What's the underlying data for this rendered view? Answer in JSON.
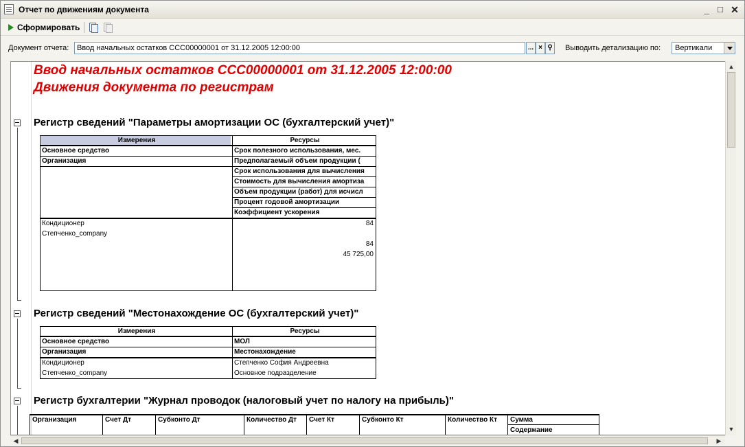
{
  "window": {
    "title": "Отчет по движениям документа",
    "minimize": "_",
    "maximize": "□",
    "close": "✕"
  },
  "toolbar": {
    "run_label": "Сформировать"
  },
  "params": {
    "doc_label": "Документ отчета:",
    "doc_value": "Ввод начальных остатков ССС00000001 от 31.12.2005 12:00:00",
    "dots": "...",
    "clear": "×",
    "detail_label": "Выводить детализацию по:",
    "detail_value": "Вертикали"
  },
  "report": {
    "title1": "Ввод начальных остатков ССС00000001 от 31.12.2005 12:00:00",
    "title2": "Движения документа по регистрам",
    "sec1": {
      "title": "Регистр сведений \"Параметры амортизации ОС (бухгалтерский учет)\"",
      "dims_header": "Измерения",
      "res_header": "Ресурсы",
      "dims": [
        "Основное средство",
        "Организация"
      ],
      "resources": [
        "Срок полезного использования, мес.",
        "Предполагаемый объем продукции (",
        "Срок использования для вычисления",
        "Стоимость для вычисления амортиза",
        "Объем продукции (работ) для исчисл",
        "Процент годовой амортизации",
        "Коэффициент ускорения"
      ],
      "dim_values": [
        "Кондиционер",
        "Степченко_company"
      ],
      "res_values": [
        "84",
        "",
        "84",
        "45 725,00"
      ]
    },
    "sec2": {
      "title": "Регистр сведений \"Местонахождение ОС (бухгалтерский учет)\"",
      "dims_header": "Измерения",
      "res_header": "Ресурсы",
      "dims": [
        "Основное средство",
        "Организация"
      ],
      "resources": [
        "МОЛ",
        "Местонахождение"
      ],
      "dim_values": [
        "Кондиционер",
        "Степченко_company"
      ],
      "res_values": [
        "Степченко София Андреевна",
        "Основное подразделение"
      ]
    },
    "sec3": {
      "title": "Регистр бухгалтерии \"Журнал проводок (налоговый учет по налогу на прибыль)\"",
      "columns": [
        "Организация",
        "Счет Дт",
        "Субконто Дт",
        "Количество Дт",
        "Счет Кт",
        "Субконто Кт",
        "Количество Кт",
        "Сумма"
      ],
      "sub_column": "Содержание"
    }
  }
}
